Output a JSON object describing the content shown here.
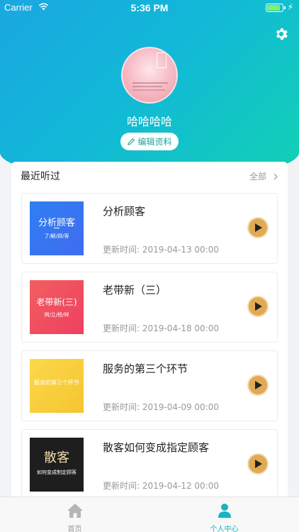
{
  "status_bar": {
    "carrier": "Carrier",
    "time": "5:36 PM"
  },
  "profile": {
    "name": "哈哈哈哈",
    "edit_label": "编辑资料"
  },
  "recent": {
    "title": "最近听过",
    "all_label": "全部",
    "items": [
      {
        "title": "分析顾客",
        "time": "更新时间: 2019-04-13 00:00",
        "thumb_title": "分析顾客",
        "thumb_sub": "了/解/顾/客"
      },
      {
        "title": "老带新（三）",
        "time": "更新时间: 2019-04-18 00:00",
        "thumb_title": "老带新(三)",
        "thumb_sub": "例/立/榜/样"
      },
      {
        "title": "服务的第三个环节",
        "time": "更新时间: 2019-04-09 00:00",
        "thumb_title": "服务的第三个环节",
        "thumb_sub": ""
      },
      {
        "title": "散客如何变成指定顾客",
        "time": "更新时间: 2019-04-12 00:00",
        "thumb_title": "散客",
        "thumb_sub": "如何变成制定顾客"
      }
    ]
  },
  "tabbar": {
    "home": "首页",
    "me": "个人中心"
  },
  "colors": {
    "accent": "#18b3c0",
    "play": "#e0aa55"
  }
}
